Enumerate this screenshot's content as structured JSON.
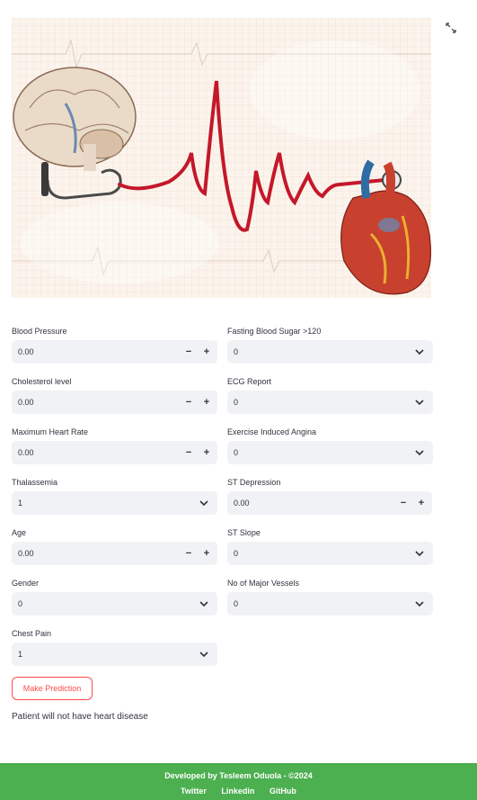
{
  "hero": {
    "image": "heart-health-illustration"
  },
  "icons": {
    "expand": "expand-icon"
  },
  "colors": {
    "accent": "#ff4b4b",
    "footer_bg": "#4caf50",
    "input_bg": "#f0f2f6",
    "ecg_line": "#c4182a"
  },
  "form": {
    "blood_pressure": {
      "label": "Blood Pressure",
      "value": "0.00"
    },
    "fasting_blood_sugar": {
      "label": "Fasting Blood Sugar >120",
      "value": "0"
    },
    "cholesterol": {
      "label": "Cholesterol level",
      "value": "0.00"
    },
    "ecg_report": {
      "label": "ECG Report",
      "value": "0"
    },
    "max_heart_rate": {
      "label": "Maximum Heart Rate",
      "value": "0.00"
    },
    "exercise_angina": {
      "label": "Exercise Induced Angina",
      "value": "0"
    },
    "thalassemia": {
      "label": "Thalassemia",
      "value": "1"
    },
    "st_depression": {
      "label": "ST Depression",
      "value": "0.00"
    },
    "age": {
      "label": "Age",
      "value": "0.00"
    },
    "st_slope": {
      "label": "ST Slope",
      "value": "0"
    },
    "gender": {
      "label": "Gender",
      "value": "0"
    },
    "major_vessels": {
      "label": "No of Major Vessels",
      "value": "0"
    },
    "chest_pain": {
      "label": "Chest Pain",
      "value": "1"
    }
  },
  "stepper": {
    "minus": "−",
    "plus": "+"
  },
  "predict_button": "Make Prediction",
  "result_text": "Patient will not have heart disease",
  "footer": {
    "developer": "Developed by Tesleem Oduola - ©2024",
    "links": [
      "Twitter",
      "Linkedin",
      "GitHub"
    ]
  }
}
